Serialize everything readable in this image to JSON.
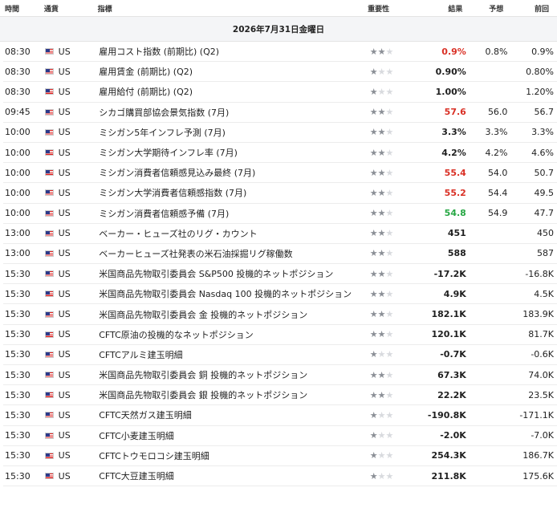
{
  "header": {
    "time": "時間",
    "currency": "通貨",
    "indicator": "指標",
    "importance": "重要性",
    "actual": "結果",
    "forecast": "予想",
    "previous": "前回"
  },
  "date_label": "2026年7月31日金曜日",
  "colors": {
    "red": "#d93025",
    "green": "#27a744",
    "star_on": "#8b8f96",
    "star_off": "#d8dade"
  },
  "rows": [
    {
      "time": "08:30",
      "cur": "US",
      "name": "雇用コスト指数 (前期比) (Q2)",
      "imp": 2,
      "actual": "0.9%",
      "actual_color": "red",
      "forecast": "0.8%",
      "previous": "0.9%"
    },
    {
      "time": "08:30",
      "cur": "US",
      "name": "雇用賃金 (前期比) (Q2)",
      "imp": 1,
      "actual": "0.90%",
      "actual_color": "dark",
      "forecast": "",
      "previous": "0.80%"
    },
    {
      "time": "08:30",
      "cur": "US",
      "name": "雇用給付 (前期比) (Q2)",
      "imp": 1,
      "actual": "1.00%",
      "actual_color": "dark",
      "forecast": "",
      "previous": "1.20%"
    },
    {
      "time": "09:45",
      "cur": "US",
      "name": "シカゴ購買部協会景気指数 (7月)",
      "imp": 2,
      "actual": "57.6",
      "actual_color": "red",
      "forecast": "56.0",
      "previous": "56.7"
    },
    {
      "time": "10:00",
      "cur": "US",
      "name": "ミシガン5年インフレ予測 (7月)",
      "imp": 2,
      "actual": "3.3%",
      "actual_color": "dark",
      "forecast": "3.3%",
      "previous": "3.3%"
    },
    {
      "time": "10:00",
      "cur": "US",
      "name": "ミシガン大学期待インフレ率 (7月)",
      "imp": 2,
      "actual": "4.2%",
      "actual_color": "dark",
      "forecast": "4.2%",
      "previous": "4.6%"
    },
    {
      "time": "10:00",
      "cur": "US",
      "name": "ミシガン消費者信頼感見込み最終 (7月)",
      "imp": 2,
      "actual": "55.4",
      "actual_color": "red",
      "forecast": "54.0",
      "previous": "50.7"
    },
    {
      "time": "10:00",
      "cur": "US",
      "name": "ミシガン大学消費者信頼感指数 (7月)",
      "imp": 2,
      "actual": "55.2",
      "actual_color": "red",
      "forecast": "54.4",
      "previous": "49.5"
    },
    {
      "time": "10:00",
      "cur": "US",
      "name": "ミシガン消費者信頼感予備 (7月)",
      "imp": 2,
      "actual": "54.8",
      "actual_color": "green",
      "forecast": "54.9",
      "previous": "47.7"
    },
    {
      "time": "13:00",
      "cur": "US",
      "name": "ベーカー・ヒューズ社のリグ・カウント",
      "imp": 2,
      "actual": "451",
      "actual_color": "dark",
      "forecast": "",
      "previous": "450"
    },
    {
      "time": "13:00",
      "cur": "US",
      "name": "ベーカーヒューズ社発表の米石油採掘リグ稼働数",
      "imp": 2,
      "actual": "588",
      "actual_color": "dark",
      "forecast": "",
      "previous": "587"
    },
    {
      "time": "15:30",
      "cur": "US",
      "name": "米国商品先物取引委員会 S&P500 投機的ネットポジション",
      "imp": 2,
      "actual": "-17.2K",
      "actual_color": "dark",
      "forecast": "",
      "previous": "-16.8K"
    },
    {
      "time": "15:30",
      "cur": "US",
      "name": "米国商品先物取引委員会 Nasdaq 100 投機的ネットポジション",
      "imp": 2,
      "actual": "4.9K",
      "actual_color": "dark",
      "forecast": "",
      "previous": "4.5K"
    },
    {
      "time": "15:30",
      "cur": "US",
      "name": "米国商品先物取引委員会 金 投機的ネットポジション",
      "imp": 2,
      "actual": "182.1K",
      "actual_color": "dark",
      "forecast": "",
      "previous": "183.9K"
    },
    {
      "time": "15:30",
      "cur": "US",
      "name": "CFTC原油の投機的なネットポジション",
      "imp": 2,
      "actual": "120.1K",
      "actual_color": "dark",
      "forecast": "",
      "previous": "81.7K"
    },
    {
      "time": "15:30",
      "cur": "US",
      "name": "CFTCアルミ建玉明細",
      "imp": 1,
      "actual": "-0.7K",
      "actual_color": "dark",
      "forecast": "",
      "previous": "-0.6K"
    },
    {
      "time": "15:30",
      "cur": "US",
      "name": "米国商品先物取引委員会 銅 投機的ネットポジション",
      "imp": 2,
      "actual": "67.3K",
      "actual_color": "dark",
      "forecast": "",
      "previous": "74.0K"
    },
    {
      "time": "15:30",
      "cur": "US",
      "name": "米国商品先物取引委員会 銀 投機的ネットポジション",
      "imp": 2,
      "actual": "22.2K",
      "actual_color": "dark",
      "forecast": "",
      "previous": "23.5K"
    },
    {
      "time": "15:30",
      "cur": "US",
      "name": "CFTC天然ガス建玉明細",
      "imp": 1,
      "actual": "-190.8K",
      "actual_color": "dark",
      "forecast": "",
      "previous": "-171.1K"
    },
    {
      "time": "15:30",
      "cur": "US",
      "name": "CFTC小麦建玉明細",
      "imp": 1,
      "actual": "-2.0K",
      "actual_color": "dark",
      "forecast": "",
      "previous": "-7.0K"
    },
    {
      "time": "15:30",
      "cur": "US",
      "name": "CFTCトウモロコシ建玉明細",
      "imp": 1,
      "actual": "254.3K",
      "actual_color": "dark",
      "forecast": "",
      "previous": "186.7K"
    },
    {
      "time": "15:30",
      "cur": "US",
      "name": "CFTC大豆建玉明細",
      "imp": 1,
      "actual": "211.8K",
      "actual_color": "dark",
      "forecast": "",
      "previous": "175.6K"
    }
  ]
}
